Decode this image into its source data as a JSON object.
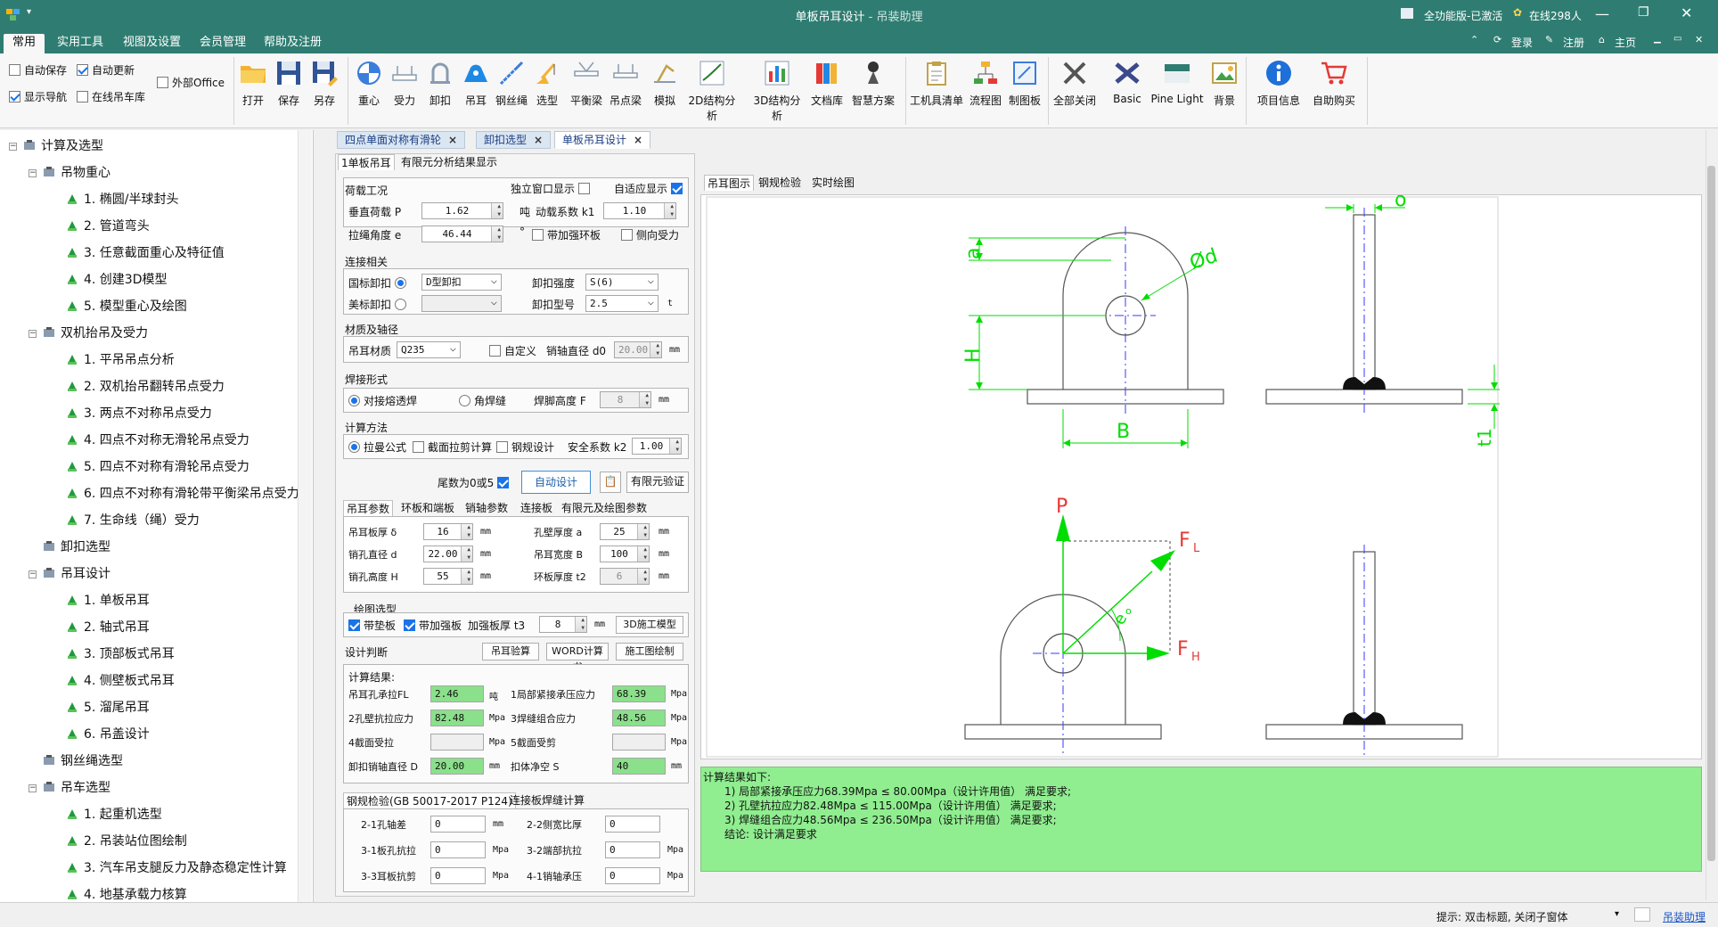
{
  "window": {
    "title": "单板吊耳设计",
    "subtitle": " - 吊装助理",
    "license": "全功能版-已激活",
    "online": "在线298人",
    "login": "登录",
    "register": "注册",
    "home": "主页"
  },
  "menu": [
    "常用",
    "实用工具",
    "视图及设置",
    "会员管理",
    "帮助及注册"
  ],
  "ribbon": {
    "checks": [
      {
        "label": "自动保存",
        "checked": false
      },
      {
        "label": "自动更新",
        "checked": true
      },
      {
        "label": "外部Office",
        "checked": false
      },
      {
        "label": "显示导航",
        "checked": true
      },
      {
        "label": "在线吊车库",
        "checked": false
      }
    ],
    "tools": [
      "打开",
      "保存",
      "另存",
      "重心",
      "受力",
      "卸扣",
      "吊耳",
      "钢丝绳",
      "选型",
      "平衡梁",
      "吊点梁",
      "模拟",
      "2D结构分析",
      "3D结构分析",
      "文档库",
      "智慧方案",
      "工机具清单",
      "流程图",
      "制图板",
      "全部关闭",
      "Basic",
      "Pine Light",
      "背景",
      "项目信息",
      "自助购买"
    ]
  },
  "tree": [
    {
      "level": 0,
      "label": "计算及选型"
    },
    {
      "level": 1,
      "label": "吊物重心"
    },
    {
      "level": 2,
      "label": "1. 椭圆/半球封头"
    },
    {
      "level": 2,
      "label": "2. 管道弯头"
    },
    {
      "level": 2,
      "label": "3. 任意截面重心及特征值"
    },
    {
      "level": 2,
      "label": "4. 创建3D模型"
    },
    {
      "level": 2,
      "label": "5. 模型重心及绘图"
    },
    {
      "level": 1,
      "label": "双机抬吊及受力"
    },
    {
      "level": 2,
      "label": "1. 平吊吊点分析"
    },
    {
      "level": 2,
      "label": "2. 双机抬吊翻转吊点受力"
    },
    {
      "level": 2,
      "label": "3. 两点不对称吊点受力"
    },
    {
      "level": 2,
      "label": "4. 四点不对称无滑轮吊点受力"
    },
    {
      "level": 2,
      "label": "5. 四点不对称有滑轮吊点受力"
    },
    {
      "level": 2,
      "label": "6. 四点不对称有滑轮带平衡梁吊点受力"
    },
    {
      "level": 2,
      "label": "7. 生命线（绳）受力"
    },
    {
      "level": 1,
      "label": "卸扣选型"
    },
    {
      "level": 1,
      "label": "吊耳设计"
    },
    {
      "level": 2,
      "label": "1. 单板吊耳"
    },
    {
      "level": 2,
      "label": "2. 轴式吊耳"
    },
    {
      "level": 2,
      "label": "3. 顶部板式吊耳"
    },
    {
      "level": 2,
      "label": "4. 侧壁板式吊耳"
    },
    {
      "level": 2,
      "label": "5. 溜尾吊耳"
    },
    {
      "level": 2,
      "label": "6. 吊盖设计"
    },
    {
      "level": 1,
      "label": "钢丝绳选型"
    },
    {
      "level": 1,
      "label": "吊车选型"
    },
    {
      "level": 2,
      "label": "1. 起重机选型"
    },
    {
      "level": 2,
      "label": "2. 吊装站位图绘制"
    },
    {
      "level": 2,
      "label": "3. 汽车吊支腿反力及静态稳定性计算"
    },
    {
      "level": 2,
      "label": "4. 地基承载力核算"
    }
  ],
  "doc_tabs": [
    "四点单面对称有滑轮",
    "卸扣选型",
    "单板吊耳设计"
  ],
  "form": {
    "tabs": [
      "1单板吊耳",
      "有限元分析结果显示"
    ],
    "load_group": "荷载工况",
    "standalone": "独立窗口显示",
    "adaptive": "自适应显示",
    "vertical_load_label": "垂直荷载 P",
    "vertical_load": "1.62",
    "vertical_load_unit": "吨",
    "dyn_coef_label": "动载系数 k1",
    "dyn_coef": "1.10",
    "angle_label": "拉绳角度 e",
    "angle": "46.44",
    "angle_unit": "°",
    "with_ring": "带加强环板",
    "side_load": "侧向受力",
    "conn_group": "连接相关",
    "gb_shackle": "国标卸扣",
    "gb_shackle_type": "D型卸扣",
    "shackle_grade_label": "卸扣强度",
    "shackle_grade": "S(6)",
    "us_shackle": "美标卸扣",
    "shackle_model_label": "卸扣型号",
    "shackle_model": "2.5",
    "shackle_model_unit": "t",
    "mat_group": "材质及轴径",
    "mat_label": "吊耳材质",
    "mat": "Q235",
    "custom": "自定义",
    "pin_dia_label": "销轴直径 d0",
    "pin_dia": "20.00",
    "pin_dia_unit": "mm",
    "weld_group": "焊接形式",
    "weld_butt": "对接熔透焊",
    "weld_fillet": "角焊缝",
    "weld_height_label": "焊脚高度 F",
    "weld_height": "8",
    "weld_height_unit": "mm",
    "calc_group": "计算方法",
    "calc_formula": "拉曼公式",
    "calc_section": "截面拉剪计算",
    "calc_steel": "钢规设计",
    "safety_label": "安全系数 k2",
    "safety": "1.00",
    "tail_label": "尾数为0或5",
    "auto_design": "自动设计",
    "fem_verify": "有限元验证",
    "param_tabs": [
      "吊耳参数",
      "环板和端板",
      "销轴参数",
      "连接板",
      "有限元及绘图参数"
    ],
    "params": [
      {
        "label": "吊耳板厚 δ",
        "value": "16",
        "unit": "mm",
        "label2": "孔壁厚度 a",
        "value2": "25",
        "unit2": "mm"
      },
      {
        "label": "销孔直径 d",
        "value": "22.00",
        "unit": "mm",
        "label2": "吊耳宽度 B",
        "value2": "100",
        "unit2": "mm"
      },
      {
        "label": "销孔高度 H",
        "value": "55",
        "unit": "mm",
        "label2": "环板厚度 t2",
        "value2": "6",
        "unit2": "mm"
      }
    ],
    "draw_group": "绘图选型",
    "with_pad": "带垫板",
    "with_stiff": "带加强板",
    "stiff_label": "加强板厚 t3",
    "stiff": "8",
    "stiff_unit": "mm",
    "model_3d": "3D施工模型",
    "judge_label": "设计判断",
    "check_btn": "吊耳验算",
    "word_btn": "WORD计算书",
    "cad_btn": "施工图绘制",
    "results_title": "计算结果:",
    "results": [
      {
        "label": "吊耳孔承拉FL",
        "value": "2.46",
        "unit": "吨",
        "label2": "1局部紧接承压应力",
        "value2": "68.39",
        "unit2": "Mpa"
      },
      {
        "label": "2孔壁抗拉应力",
        "value": "82.48",
        "unit": "Mpa",
        "label2": "3焊缝组合应力",
        "value2": "48.56",
        "unit2": "Mpa"
      },
      {
        "label": "4截面受拉",
        "value": "",
        "unit": "Mpa",
        "label2": "5截面受剪",
        "value2": "",
        "unit2": "Mpa"
      },
      {
        "label": "卸扣销轴直径 D",
        "value": "20.00",
        "unit": "mm",
        "label2": "扣体净空 S",
        "value2": "40",
        "unit2": "mm"
      }
    ],
    "bottom_tabs": [
      "钢规检验(GB 50017-2017 P124)",
      "连接板焊缝计算"
    ],
    "bottom": [
      {
        "label": "2-1孔轴差",
        "value": "0",
        "unit": "mm",
        "label2": "2-2侧宽比厚",
        "value2": "0",
        "unit2": ""
      },
      {
        "label": "3-1板孔抗拉",
        "value": "0",
        "unit": "Mpa",
        "label2": "3-2端部抗拉",
        "value2": "0",
        "unit2": "Mpa"
      },
      {
        "label": "3-3耳板抗剪",
        "value": "0",
        "unit": "Mpa",
        "label2": "4-1销轴承压",
        "value2": "0",
        "unit2": "Mpa"
      }
    ]
  },
  "draw_tabs": [
    "吊耳图示",
    "钢规检验",
    "实时绘图"
  ],
  "drawing": {
    "a": "a",
    "H": "H",
    "B": "B",
    "d": "Ød",
    "delta": "δ",
    "t1": "t1",
    "P": "P",
    "FL": "F",
    "FL_sub": "L",
    "FH": "F",
    "FH_sub": "H",
    "e": "e",
    "e_sup": "o"
  },
  "results_panel": [
    "计算结果如下:",
    "1) 局部紧接承压应力68.39Mpa ≤ 80.00Mpa（设计许用值） 满足要求;",
    "2) 孔壁抗拉应力82.48Mpa ≤ 115.00Mpa（设计许用值） 满足要求;",
    "3) 焊缝组合应力48.56Mpa ≤ 236.50Mpa（设计许用值） 满足要求;",
    "结论: 设计满足要求"
  ],
  "status": {
    "hint": "提示: 双击标题, 关闭子窗体",
    "link": "吊装助理"
  },
  "colors": {
    "titlebar": "#2f7d72",
    "green_dim": "#00dd00",
    "result_bg": "#90ee90",
    "check_blue": "#1a73e8"
  }
}
